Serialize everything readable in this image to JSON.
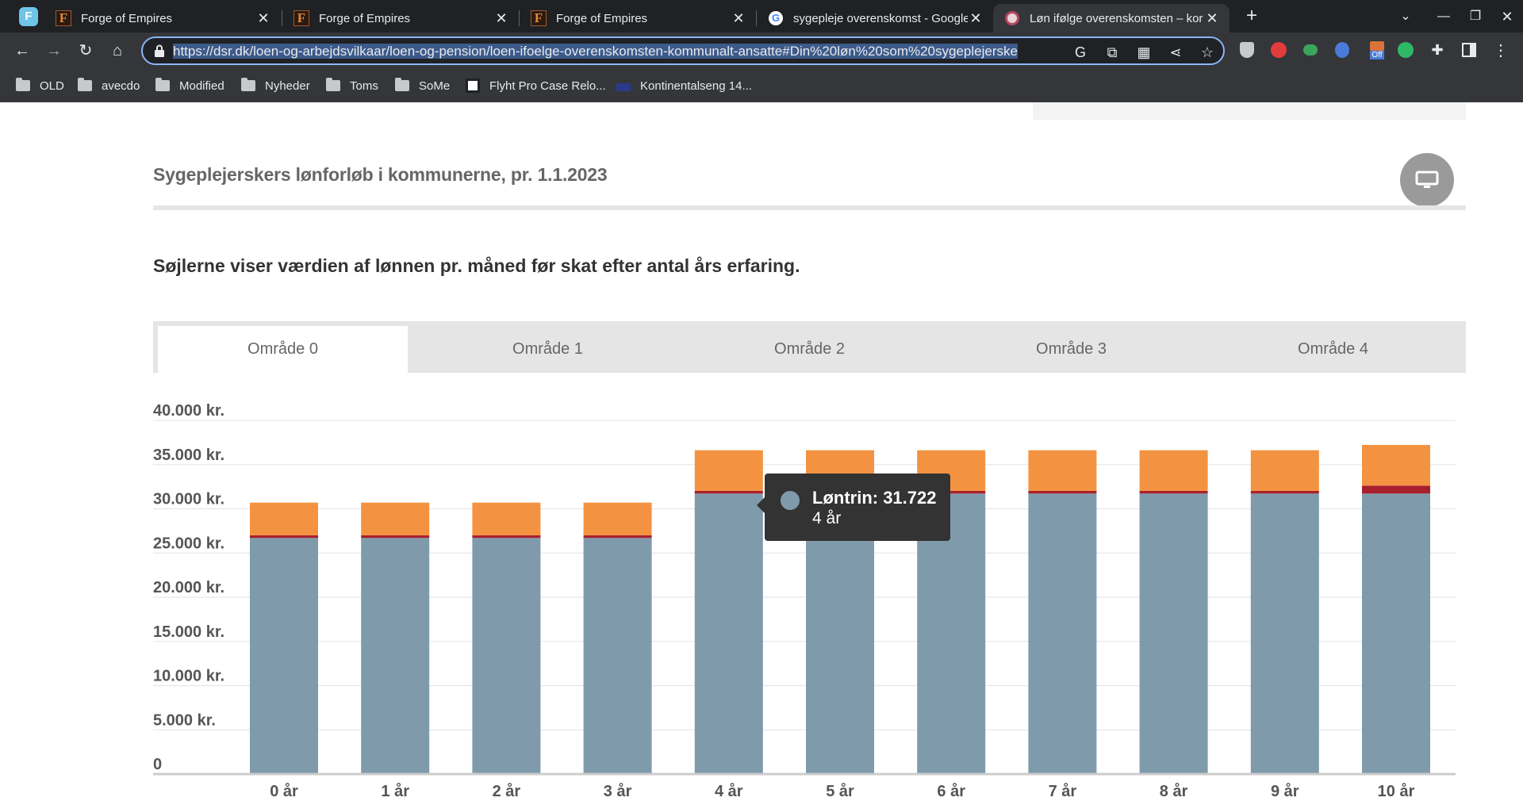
{
  "browser": {
    "profile_letter": "F",
    "tabs": [
      {
        "title": "Forge of Empires",
        "favicon": "foe-icon"
      },
      {
        "title": "Forge of Empires",
        "favicon": "foe-icon"
      },
      {
        "title": "Forge of Empires",
        "favicon": "foe-icon"
      },
      {
        "title": "sygepleje overenskomst - Google",
        "favicon": "google-icon"
      },
      {
        "title": "Løn ifølge overenskomsten – kor",
        "favicon": "dsr-icon"
      }
    ],
    "url": "https://dsr.dk/loen-og-arbejdsvilkaar/loen-og-pension/loen-ifoelge-overenskomsten-kommunalt-ansatte#Din%20løn%20som%20sygeplejerske",
    "extension_badge": "Off",
    "bookmarks": [
      "OLD",
      "avecdo",
      "Modified",
      "Nyheder",
      "Toms",
      "SoMe",
      "Flyht Pro Case Relo...",
      "Kontinentalseng 14..."
    ]
  },
  "page": {
    "section_title": "Sygeplejerskers lønforløb i kommunerne, pr. 1.1.2023",
    "description": "Søjlerne viser værdien af lønnen pr. måned før skat efter antal års erfaring.",
    "region_tabs": [
      "Område 0",
      "Område 1",
      "Område 2",
      "Område 3",
      "Område 4"
    ],
    "active_tab": 0
  },
  "tooltip": {
    "line1": "Løntrin: 31.722",
    "line2": "4 år"
  },
  "chart_data": {
    "type": "bar",
    "stacked": true,
    "categories": [
      "0 år",
      "1 år",
      "2 år",
      "3 år",
      "4 år",
      "5 år",
      "6 år",
      "7 år",
      "8 år",
      "9 år",
      "10 år"
    ],
    "ytick_labels": [
      "0",
      "5.000 kr.",
      "10.000 kr.",
      "15.000 kr.",
      "20.000 kr.",
      "25.000 kr.",
      "30.000 kr.",
      "35.000 kr.",
      "40.000 kr."
    ],
    "ylim": [
      0,
      40000
    ],
    "grid": true,
    "series": [
      {
        "name": "Løntrin",
        "color": "#7f9bab",
        "values": [
          26700,
          26700,
          26700,
          26700,
          31722,
          31722,
          31722,
          31722,
          31722,
          31722,
          31722
        ]
      },
      {
        "color": "#a8202e",
        "values": [
          300,
          300,
          300,
          300,
          300,
          300,
          300,
          300,
          300,
          300,
          900
        ]
      },
      {
        "color": "#f39341",
        "values": [
          3700,
          3700,
          3700,
          3700,
          4600,
          4600,
          4600,
          4600,
          4600,
          4600,
          4600
        ]
      }
    ]
  }
}
